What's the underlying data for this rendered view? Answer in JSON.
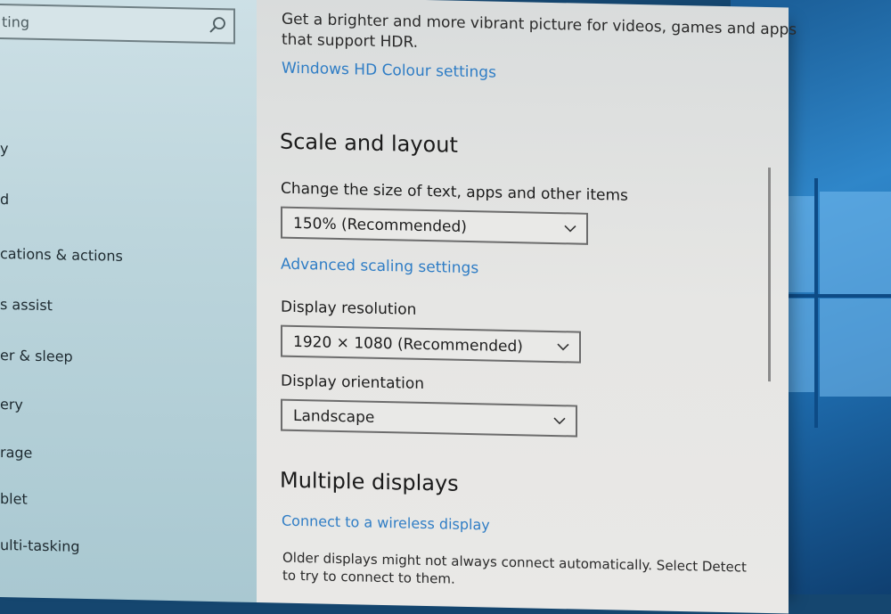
{
  "sidebar": {
    "search_value": "ting",
    "items": [
      {
        "label": "y"
      },
      {
        "label": "d"
      },
      {
        "label": "cations & actions"
      },
      {
        "label": "s assist"
      },
      {
        "label": "er & sleep"
      },
      {
        "label": "ery"
      },
      {
        "label": "rage"
      },
      {
        "label": "blet"
      },
      {
        "label": "ulti-tasking"
      }
    ]
  },
  "hdr": {
    "description_line1": "Get a brighter and more vibrant picture for videos, games and apps",
    "description_line2": "that support HDR.",
    "link": "Windows HD Colour settings"
  },
  "scale_layout": {
    "heading": "Scale and layout",
    "size_label": "Change the size of text, apps and other items",
    "size_value": "150% (Recommended)",
    "advanced_link": "Advanced scaling settings",
    "resolution_label": "Display resolution",
    "resolution_value": "1920 × 1080 (Recommended)",
    "orientation_label": "Display orientation",
    "orientation_value": "Landscape"
  },
  "multiple_displays": {
    "heading": "Multiple displays",
    "wireless_link": "Connect to a wireless display",
    "note_line1": "Older displays might not always connect automatically. Select Detect",
    "note_line2": "to try to connect to them."
  },
  "colors": {
    "link": "#2f7dc5",
    "sidebar_bg": "#bcd5dc",
    "content_bg": "#e6e6e4",
    "wallpaper": "#2f86c9"
  }
}
